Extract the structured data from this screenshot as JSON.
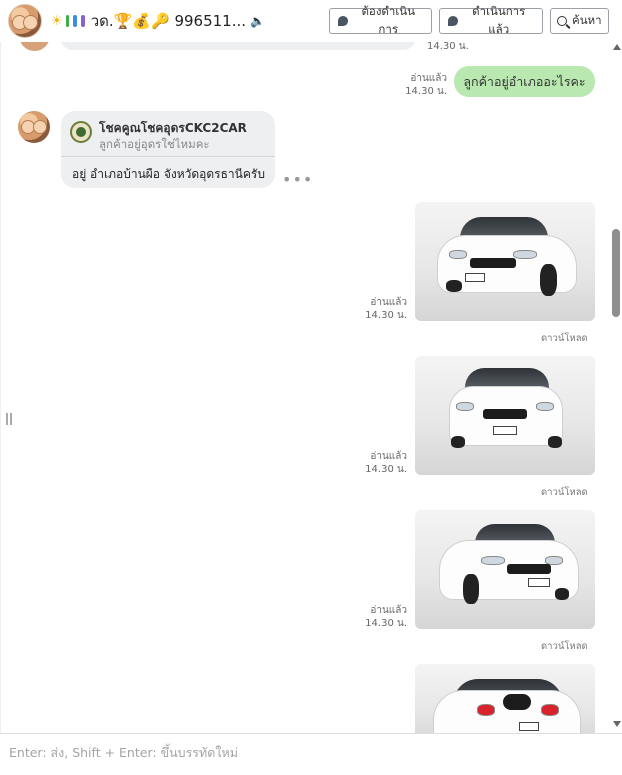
{
  "header": {
    "title": "วด.🏆💰🔑 996511...",
    "todo_label": "ต้องดำเนินการ",
    "done_label": "ดำเนินการแล้ว",
    "search_label": "ค้นหา"
  },
  "messages": {
    "top_time": "14.30 น.",
    "sent": {
      "read": "อ่านแล้ว",
      "time": "14.30 น.",
      "text": "ลูกค้าอยู่อำเภออะไรคะ"
    },
    "received": {
      "reply_name": "โชคคูณโชคอุดรCKC2CAR",
      "reply_text": "ลูกค้าอยู่อุดรใช่ไหมคะ",
      "text": "อยู่ อำเภอบ้านผือ จังหวัดอุดรธานีครับ"
    },
    "images": [
      {
        "read": "อ่านแล้ว",
        "time": "14.30 น.",
        "download": "ดาวน์โหลด"
      },
      {
        "read": "อ่านแล้ว",
        "time": "14.30 น.",
        "download": "ดาวน์โหลด"
      },
      {
        "read": "อ่านแล้ว",
        "time": "14.30 น.",
        "download": "ดาวน์โหลด"
      }
    ]
  },
  "composer": {
    "placeholder": "Enter: ส่ง, Shift + Enter: ขึ้นบรรทัดใหม่"
  },
  "colors": {
    "sent_bubble": "#b9e9b0",
    "received_bubble": "#eeeff1"
  }
}
